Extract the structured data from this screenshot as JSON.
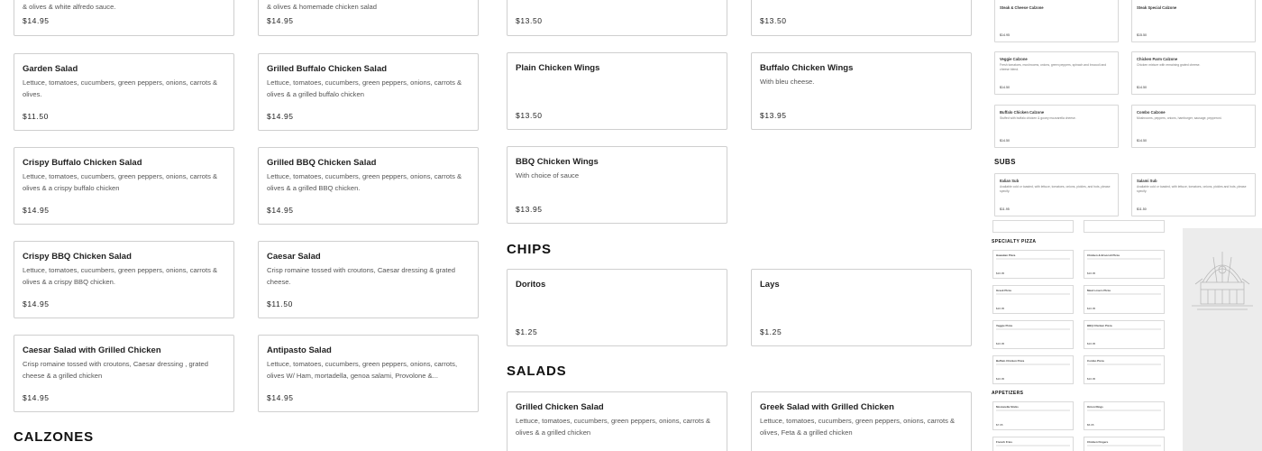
{
  "col1_top": {
    "desc": "& olives & white alfredo sauce.",
    "price": "$14.95"
  },
  "col2_top": {
    "desc": "& olives & homemade chicken salad",
    "price": "$14.95"
  },
  "col3_top": {
    "price": "$13.50"
  },
  "col4_top": {
    "price": "$13.50"
  },
  "col1": [
    {
      "name": "Garden Salad",
      "desc": "Lettuce, tomatoes, cucumbers, green peppers, onions, carrots & olives.",
      "price": "$11.50"
    },
    {
      "name": "Crispy Buffalo Chicken Salad",
      "desc": "Lettuce, tomatoes, cucumbers, green peppers, onions, carrots & olives & a crispy buffalo chicken",
      "price": "$14.95"
    },
    {
      "name": "Crispy BBQ Chicken Salad",
      "desc": "Lettuce, tomatoes, cucumbers, green peppers, onions, carrots & olives & a crispy BBQ chicken.",
      "price": "$14.95"
    },
    {
      "name": "Caesar Salad with Grilled Chicken",
      "desc": "Crisp romaine tossed with croutons, Caesar dressing , grated cheese & a grilled chicken",
      "price": "$14.95"
    }
  ],
  "col2": [
    {
      "name": "Grilled Buffalo Chicken Salad",
      "desc": "Lettuce, tomatoes, cucumbers, green peppers, onions, carrots & olives & a grilled buffalo chicken",
      "price": "$14.95"
    },
    {
      "name": "Grilled BBQ Chicken Salad",
      "desc": "Lettuce, tomatoes, cucumbers, green peppers, onions, carrots & olives & a grilled BBQ chicken.",
      "price": "$14.95"
    },
    {
      "name": "Caesar Salad",
      "desc": "Crisp romaine tossed with croutons, Caesar dressing & grated cheese.",
      "price": "$11.50"
    },
    {
      "name": "Antipasto Salad",
      "desc": "Lettuce, tomatoes, cucumbers, green peppers, onions, carrots, olives W/ Ham, mortadella, genoa salami, Provolone &...",
      "price": "$14.95"
    }
  ],
  "col3": [
    {
      "name": "Plain Chicken Wings",
      "desc": "",
      "price": "$13.50"
    },
    {
      "name": "BBQ Chicken Wings",
      "desc": "With choice of sauce",
      "price": "$13.95"
    }
  ],
  "col4": [
    {
      "name": "Buffalo Chicken Wings",
      "desc": "With bleu cheese.",
      "price": "$13.95"
    }
  ],
  "sections": {
    "calzones": "CALZONES",
    "chips": "CHIPS",
    "salads": "SALADS"
  },
  "chips": [
    {
      "name": "Doritos",
      "price": "$1.25"
    },
    {
      "name": "Lays",
      "price": "$1.25"
    }
  ],
  "salads_bottom": [
    {
      "name": "Grilled Chicken Salad",
      "desc": "Lettuce, tomatoes, cucumbers, green peppers, onions, carrots & olives & a grilled chicken"
    },
    {
      "name": "Greek Salad with Grilled Chicken",
      "desc": "Lettuce, tomatoes, cucumbers, green peppers, onions, carrots & olives, Feta & a grilled chicken"
    }
  ],
  "preview": {
    "top": [
      {
        "name": "Steak & Cheese Calzone",
        "desc": "",
        "price": "$14.95"
      },
      {
        "name": "Steak Special Calzone",
        "desc": "",
        "price": "$15.50"
      }
    ],
    "rows": [
      {
        "name": "Veggie Calzone",
        "desc": "Fresh tomatoes, mushrooms, onions, green peppers, spinach and broccoli and cheese blend.",
        "price": "$14.50"
      },
      {
        "name": "Chicken Parm Calzone",
        "desc": "Chicken mixture with remaining grated cheese.",
        "price": "$14.50"
      },
      {
        "name": "Buffalo Chicken Calzone",
        "desc": "Stuffed with buffalo chicken & gooey mozzarella cheese.",
        "price": "$14.50"
      },
      {
        "name": "Combo Calzone",
        "desc": "Mushrooms, peppers, onions, hamburger, sausage, pepperoni.",
        "price": "$14.50"
      }
    ],
    "subs_title": "SUBS",
    "subs": [
      {
        "name": "Italian Sub",
        "desc": "Available cold or toasted, with lettuce, tomatoes, onions, pickles, and hots, please specify.",
        "price": "$11.95"
      },
      {
        "name": "Salami Sub",
        "desc": "Available cold or toasted, with lettuce, tomatoes, onions, pickles and hots, please specify.",
        "price": "$11.50"
      }
    ],
    "pizza_title": "SPECIALTY PIZZA",
    "pizza": [
      {
        "name": "Hawaiian Pizza",
        "price": "$16.95"
      },
      {
        "name": "Chicken & Broccoli Pizza",
        "price": "$16.95"
      },
      {
        "name": "Greek Pizza",
        "price": "$16.95"
      },
      {
        "name": "Meat Lovers Pizza",
        "price": "$16.95"
      },
      {
        "name": "Veggie Pizza",
        "price": "$16.95"
      },
      {
        "name": "BBQ Chicken Pizza",
        "price": "$16.95"
      },
      {
        "name": "Buffalo Chicken Pizza",
        "price": "$16.95"
      },
      {
        "name": "Combo Pizza",
        "price": "$16.95"
      }
    ],
    "apps_title": "APPETIZERS",
    "apps": [
      {
        "name": "Mozzarella Sticks",
        "price": "$7.95"
      },
      {
        "name": "Onion Rings",
        "price": "$5.95"
      },
      {
        "name": "French Fries",
        "price": ""
      },
      {
        "name": "Chicken Fingers",
        "price": ""
      }
    ]
  }
}
